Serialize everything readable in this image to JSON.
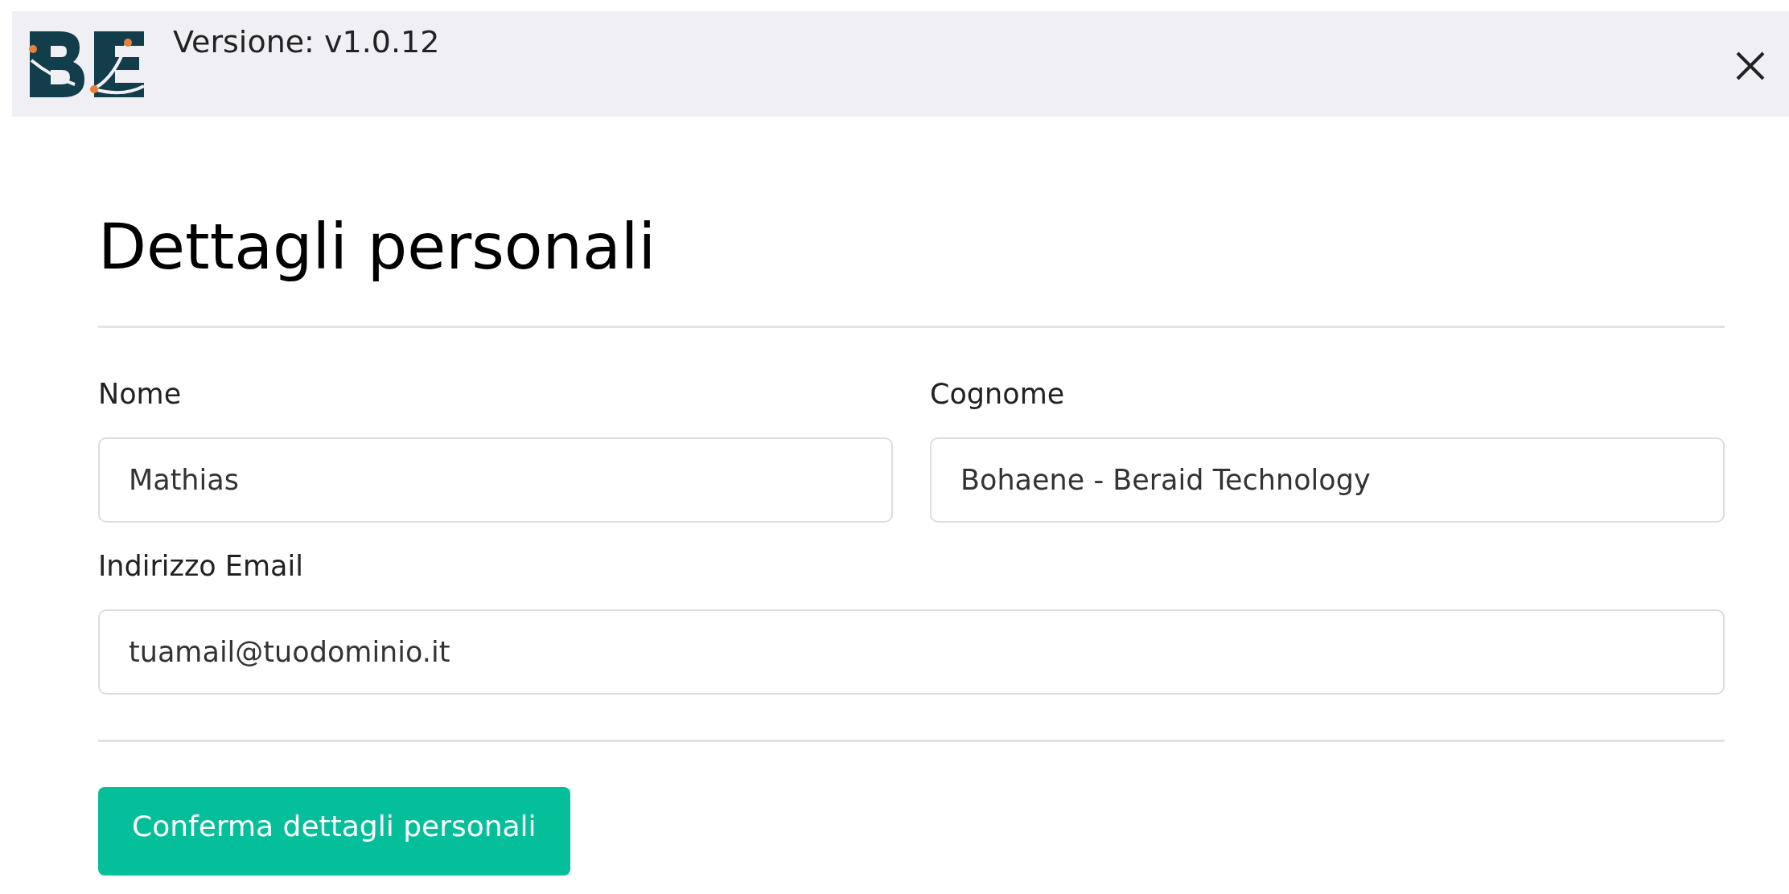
{
  "header": {
    "version": "Versione: v1.0.12"
  },
  "title": "Dettagli personali",
  "fields": [
    {
      "label": "Nome",
      "value": "Mathias"
    },
    {
      "label": "Cognome",
      "value": "Bohaene - Beraid Technology"
    },
    {
      "label": "Indirizzo Email",
      "value": "tuamail@tuodominio.it"
    }
  ],
  "submit_button": "Conferma dettagli personali"
}
